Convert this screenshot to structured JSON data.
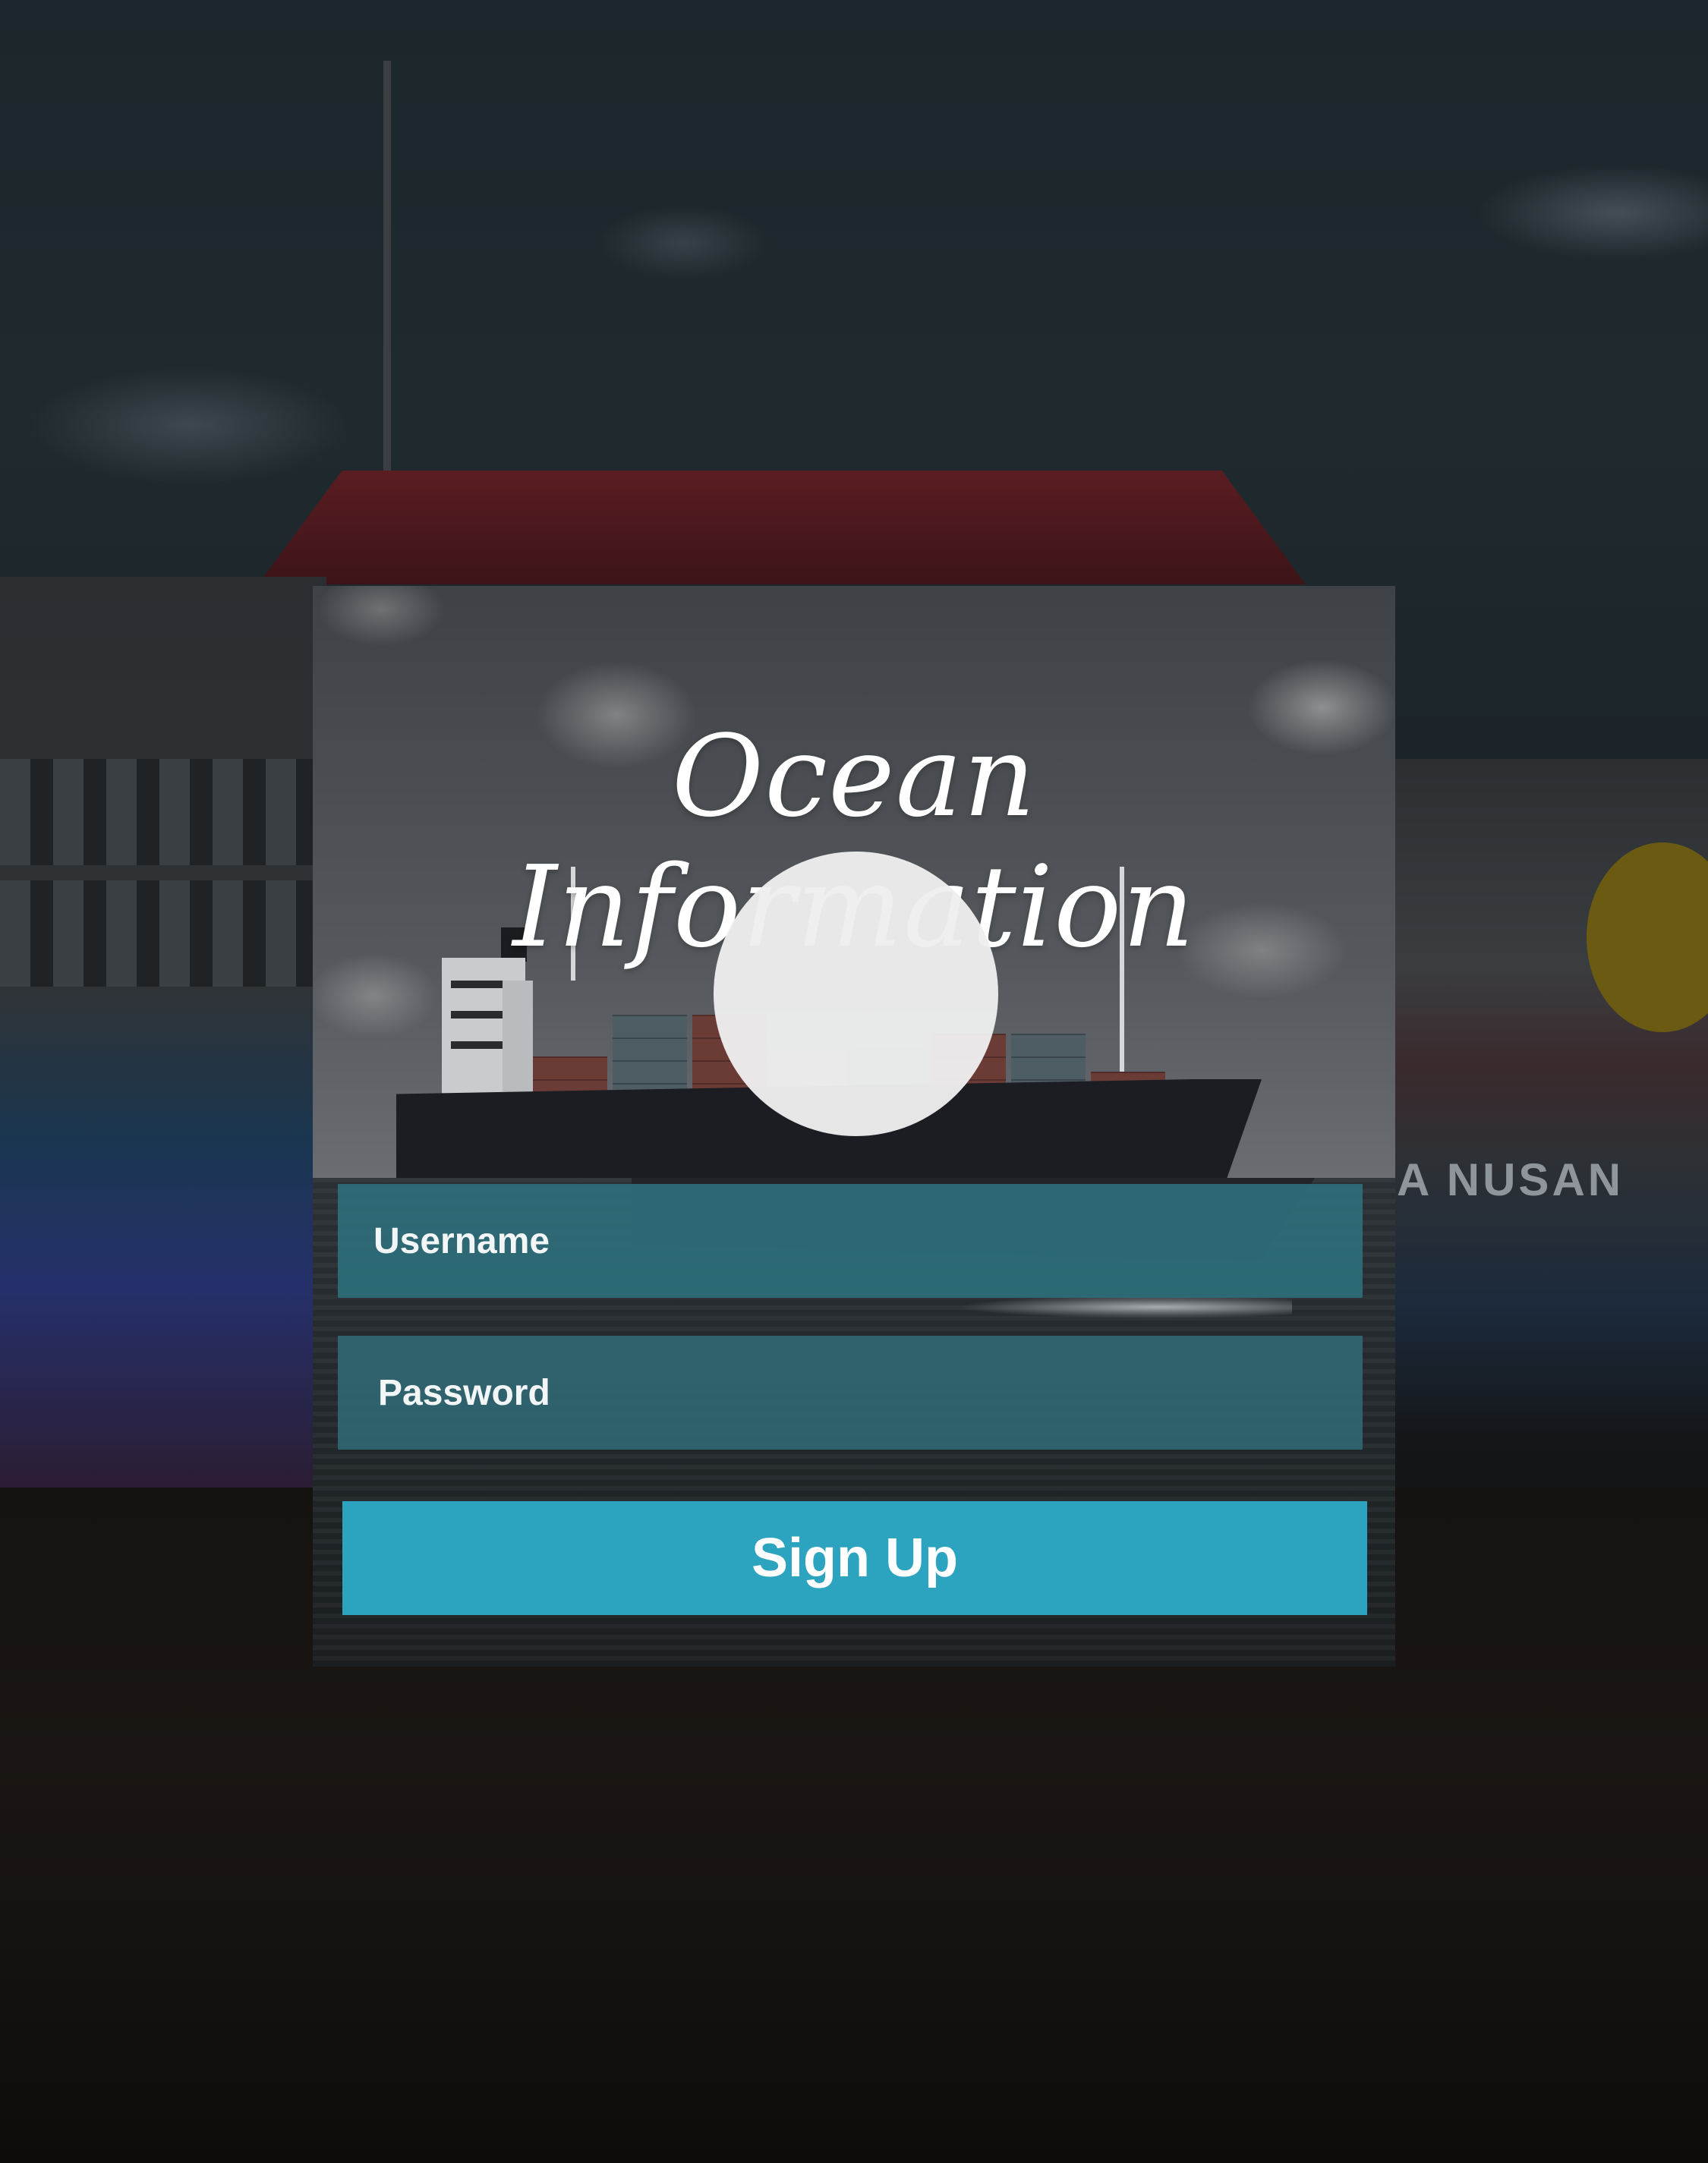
{
  "app": {
    "title": "Ocean Information"
  },
  "background": {
    "hull_text": "A NUSAN"
  },
  "login_form": {
    "username_placeholder": "Username",
    "password_placeholder": "Password",
    "submit_label": "Sign Up"
  },
  "colors": {
    "field_background": "#2e6e7a",
    "button_background": "#2ca3bf",
    "text": "#ffffff"
  }
}
